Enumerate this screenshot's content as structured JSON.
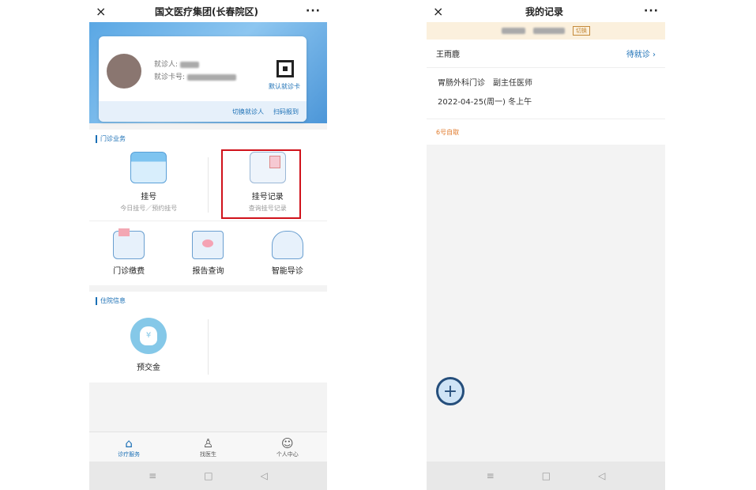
{
  "left": {
    "title": "国文医疗集团(长春院区)",
    "patient": {
      "name_label": "就诊人:",
      "card_label": "就诊卡号:"
    },
    "qr_label": "默认就诊卡",
    "switch_patient": "切换就诊人",
    "scan": "扫码报到",
    "outpatient": {
      "heading": "门诊业务",
      "register": {
        "name": "挂号",
        "sub": "今日挂号／预约挂号"
      },
      "records": {
        "name": "挂号记录",
        "sub": "查询挂号记录"
      },
      "pay": "门诊缴费",
      "report": "报告查询",
      "guide": "智能导诊"
    },
    "inpatient": {
      "heading": "住院信息",
      "deposit": "预交金",
      "coin_symbol": "¥"
    },
    "tabs": [
      "诊疗服务",
      "找医生",
      "个人中心"
    ]
  },
  "right": {
    "title": "我的记录",
    "notice_switch": "切换",
    "record": {
      "patient": "王雨鹿",
      "status": "待就诊",
      "dept": "胃肠外科门诊　副主任医师",
      "date": "2022-04-25(周一)  冬上午",
      "note": "6号自取"
    }
  },
  "icons": {
    "close": "×",
    "more": "···",
    "chevron": "›",
    "plus": "+",
    "menu": "≡",
    "home": "□",
    "back": "◁"
  }
}
